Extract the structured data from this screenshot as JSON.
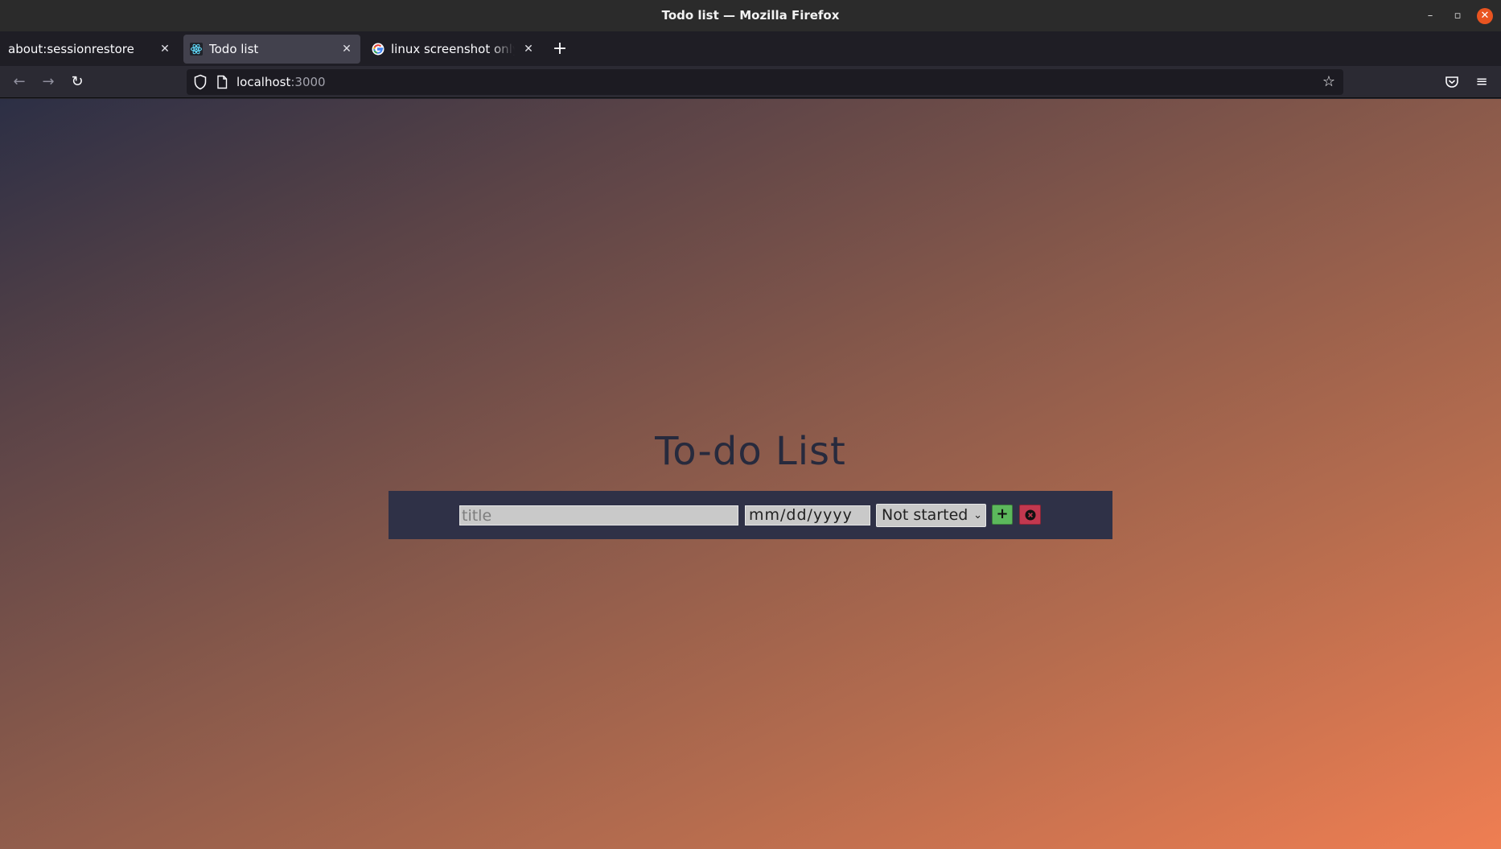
{
  "window": {
    "title": "Todo list — Mozilla Firefox",
    "controls": {
      "minimize": "–",
      "maximize": "▫",
      "close": "✕"
    }
  },
  "tabs": [
    {
      "label": "about:sessionrestore",
      "active": false
    },
    {
      "label": "Todo list",
      "active": true,
      "favicon": "react-icon"
    },
    {
      "label": "linux screenshot only one",
      "active": false,
      "favicon": "google-icon"
    }
  ],
  "new_tab_label": "+",
  "navbar": {
    "back": "←",
    "forward": "→",
    "reload": "↻",
    "url_host": "localhost",
    "url_port": ":3000",
    "bookmark_star": "☆",
    "menu": "≡"
  },
  "page": {
    "heading": "To-do List",
    "form": {
      "title_placeholder": "title",
      "date_value": "mm/dd/yyyy",
      "status_selected": "Not started",
      "add_label": "+"
    }
  },
  "colors": {
    "panel": "#2f3147",
    "add_button": "#5cb85c",
    "clear_button": "#c2384f",
    "heading": "#272a3d",
    "window_close": "#e95420"
  }
}
